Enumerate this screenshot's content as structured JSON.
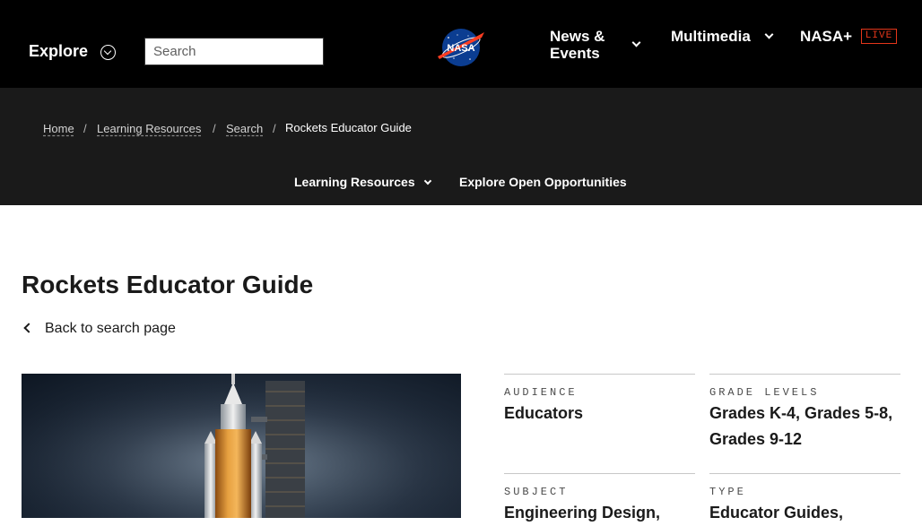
{
  "header": {
    "explore_label": "Explore",
    "search_placeholder": "Search",
    "nav": {
      "news_events": "News & Events",
      "multimedia": "Multimedia",
      "nasa_plus": "NASA+",
      "live_badge": "LIVE"
    }
  },
  "breadcrumb": {
    "home": "Home",
    "learning_resources": "Learning Resources",
    "search": "Search",
    "current": "Rockets Educator Guide",
    "separator": "/"
  },
  "subnav": {
    "learning_resources": "Learning Resources",
    "explore_opportunities": "Explore Open Opportunities"
  },
  "page": {
    "title": "Rockets Educator Guide",
    "back_link": "Back to search page"
  },
  "meta": {
    "audience_label": "AUDIENCE",
    "audience_value": "Educators",
    "grade_label": "GRADE LEVELS",
    "grade_value": "Grades K-4, Grades 5-8, Grades 9-12",
    "subject_label": "SUBJECT",
    "subject_value": "Engineering Design,",
    "type_label": "TYPE",
    "type_value": "Educator Guides,"
  },
  "colors": {
    "top_bar": "#000000",
    "sub_band": "#1a1a1a",
    "live_accent": "#e4361a",
    "nasa_blue": "#0b3d91",
    "nasa_red": "#fc3d21"
  },
  "icons": {
    "explore": "chevron-circle-icon",
    "logo": "nasa-meatball-logo",
    "dropdown": "chevron-down-icon",
    "back": "chevron-left-icon"
  }
}
